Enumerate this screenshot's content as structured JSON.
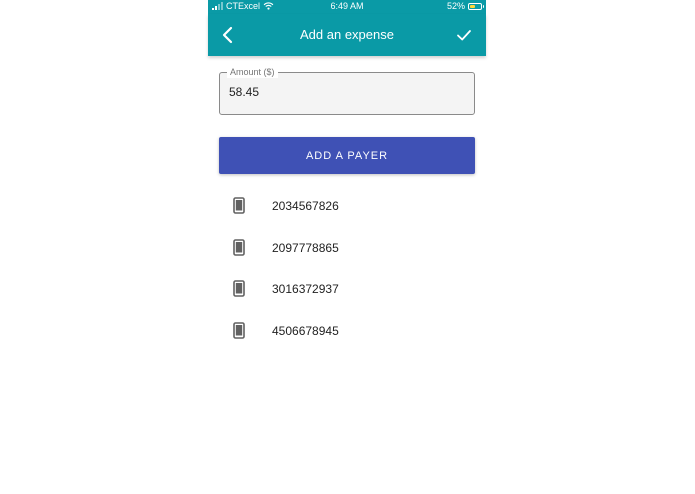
{
  "status_bar": {
    "carrier": "CTExcel",
    "time": "6:49 AM",
    "battery_percent": "52%",
    "battery_level": 0.52,
    "icons": [
      "signal-icon",
      "wifi-icon",
      "battery-icon"
    ]
  },
  "app_bar": {
    "title": "Add an expense",
    "back_icon": "chevron-left-icon",
    "confirm_icon": "check-icon",
    "background_color": "#0a9aa6"
  },
  "form": {
    "amount_label": "Amount ($)",
    "amount_value": "58.45",
    "add_payer_label": "ADD A PAYER",
    "button_color": "#3f51b5"
  },
  "payers": [
    {
      "icon": "smartphone-icon",
      "number": "2034567826"
    },
    {
      "icon": "smartphone-icon",
      "number": "2097778865"
    },
    {
      "icon": "smartphone-icon",
      "number": "3016372937"
    },
    {
      "icon": "smartphone-icon",
      "number": "4506678945"
    }
  ]
}
